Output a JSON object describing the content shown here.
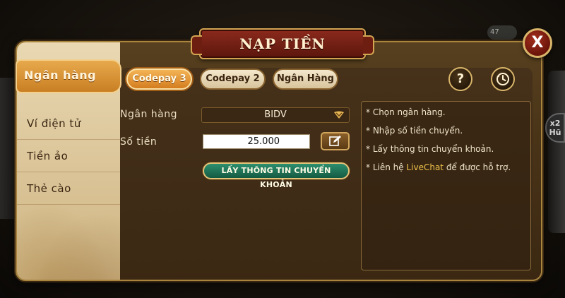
{
  "background": {
    "top_badge": "47",
    "right_badge": "x2 Hũ"
  },
  "dialog": {
    "title": "NẠP TIỀN",
    "close_label": "X"
  },
  "sidebar": {
    "items": [
      {
        "label": "Ngân hàng",
        "active": true
      },
      {
        "label": "Ví điện tử",
        "active": false
      },
      {
        "label": "Tiền ảo",
        "active": false
      },
      {
        "label": "Thẻ cào",
        "active": false
      }
    ]
  },
  "tabs": [
    {
      "label": "Codepay 3",
      "active": true
    },
    {
      "label": "Codepay 2",
      "active": false
    },
    {
      "label": "Ngân Hàng",
      "active": false
    }
  ],
  "toolbar": {
    "help_label": "?",
    "history_icon": "clock-icon"
  },
  "form": {
    "bank_label": "Ngân hàng",
    "bank_value": "BIDV",
    "amount_label": "Số tiền",
    "amount_value": "25.000",
    "get_info_button": "LẤY THÔNG TIN CHUYỂN KHOẢN"
  },
  "notes": {
    "line1": "* Chọn ngân hàng.",
    "line2": "* Nhập số tiền chuyển.",
    "line3": "* Lấy thông tin chuyển khoản.",
    "line4_prefix": "* Liên hệ ",
    "line4_link": "LiveChat",
    "line4_suffix": " để được hỗ trợ."
  },
  "colors": {
    "accent_orange": "#d47d1f",
    "accent_green": "#145a42",
    "gold": "#d8b56a",
    "close_red": "#a3301e"
  }
}
